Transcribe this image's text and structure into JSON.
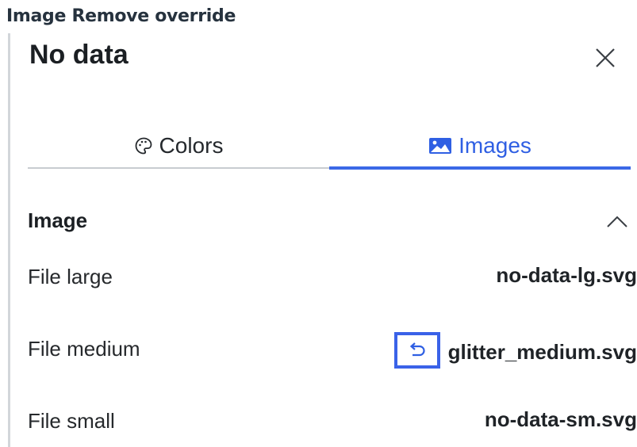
{
  "caption": "Image Remove override",
  "panel": {
    "title": "No data",
    "close_icon": "close-icon"
  },
  "tabs": [
    {
      "label": "Colors",
      "icon": "palette-icon",
      "active": false
    },
    {
      "label": "Images",
      "icon": "image-icon",
      "active": true
    }
  ],
  "section": {
    "title": "Image",
    "toggle_icon": "chevron-up-icon",
    "rows": [
      {
        "label": "File large",
        "value": "no-data-lg.svg",
        "overridden": false
      },
      {
        "label": "File medium",
        "value": "glitter_medium.svg",
        "overridden": true,
        "revert_icon": "undo-icon"
      },
      {
        "label": "File small",
        "value": "no-data-sm.svg",
        "overridden": false
      }
    ]
  },
  "colors": {
    "accent": "#3b68e6",
    "active_tab_text": "#2f5fe3",
    "divider": "#c8ccd0"
  }
}
